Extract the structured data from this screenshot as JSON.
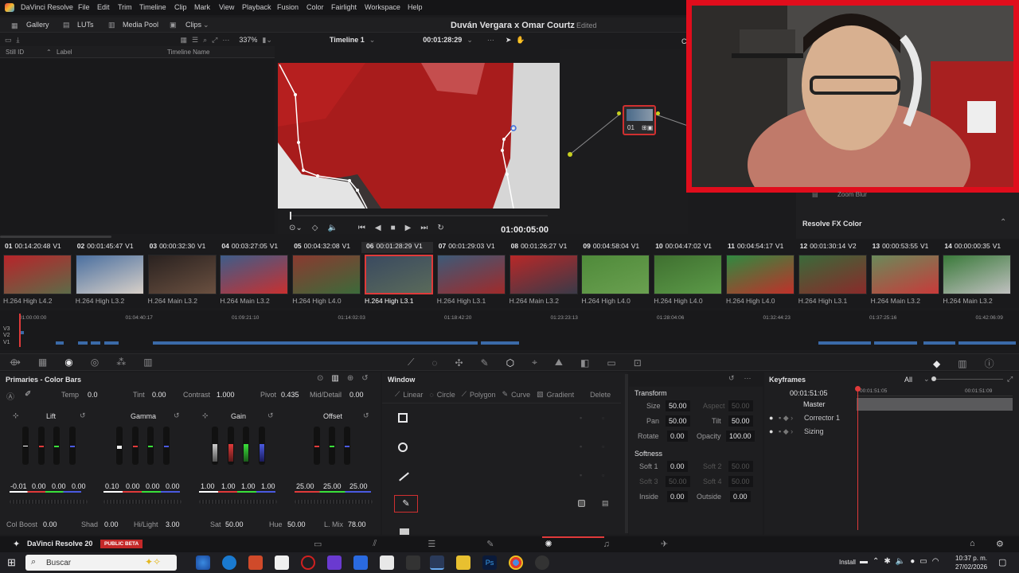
{
  "menubar": {
    "app": "DaVinci Resolve",
    "items": [
      "File",
      "Edit",
      "Trim",
      "Timeline",
      "Clip",
      "Mark",
      "View",
      "Playback",
      "Fusion",
      "Color",
      "Fairlight",
      "Workspace",
      "Help"
    ],
    "project_title": "Duván Vergara x Omar Courtz",
    "status": "Edited"
  },
  "toolbar": {
    "gallery": "Gallery",
    "luts": "LUTs",
    "media_pool": "Media Pool",
    "clips": "Clips",
    "zoom": "337%",
    "timeline": "Timeline 1",
    "timecode": "00:01:28:29"
  },
  "gallery": {
    "columns": [
      "Still ID",
      "Label",
      "Timeline Name"
    ]
  },
  "viewer": {
    "timecode": "01:00:05:00"
  },
  "node": {
    "label": "01"
  },
  "fx": {
    "item": "Zoom Blur",
    "title": "Resolve FX Color"
  },
  "clips": [
    {
      "num": "01",
      "tc": "00:14:20:48",
      "track": "V1",
      "codec": "H.264 High L4.2",
      "c1": "#b8242a",
      "c2": "#5d6b48"
    },
    {
      "num": "02",
      "tc": "00:01:45:47",
      "track": "V1",
      "codec": "H.264 High L3.2",
      "c1": "#4a6fa0",
      "c2": "#d8d0c8"
    },
    {
      "num": "03",
      "tc": "00:00:32:30",
      "track": "V1",
      "codec": "H.264 Main L3.2",
      "c1": "#2a2220",
      "c2": "#6a5040"
    },
    {
      "num": "04",
      "tc": "00:03:27:05",
      "track": "V1",
      "codec": "H.264 Main L3.2",
      "c1": "#3d5d8a",
      "c2": "#c83030"
    },
    {
      "num": "05",
      "tc": "00:04:32:08",
      "track": "V1",
      "codec": "H.264 High L4.0",
      "c1": "#8a3a30",
      "c2": "#3c6a3a"
    },
    {
      "num": "06",
      "tc": "00:01:28:29",
      "track": "V1",
      "codec": "H.264 High L3.1",
      "c1": "#3a4a60",
      "c2": "#5a6a5a",
      "selected": true
    },
    {
      "num": "07",
      "tc": "00:01:29:03",
      "track": "V1",
      "codec": "H.264 High L3.1",
      "c1": "#3c5a78",
      "c2": "#a02a2a"
    },
    {
      "num": "08",
      "tc": "00:01:26:27",
      "track": "V1",
      "codec": "H.264 Main L3.2",
      "c1": "#b82828",
      "c2": "#3a3a48"
    },
    {
      "num": "09",
      "tc": "00:04:58:04",
      "track": "V1",
      "codec": "H.264 High L4.0",
      "c1": "#4f8a3a",
      "c2": "#6aa050"
    },
    {
      "num": "10",
      "tc": "00:04:47:02",
      "track": "V1",
      "codec": "H.264 High L4.0",
      "c1": "#3f7030",
      "c2": "#5c9a48"
    },
    {
      "num": "11",
      "tc": "00:04:54:17",
      "track": "V1",
      "codec": "H.264 High L4.0",
      "c1": "#2f8a40",
      "c2": "#c0302a"
    },
    {
      "num": "12",
      "tc": "00:01:30:14",
      "track": "V2",
      "codec": "H.264 High L3.1",
      "c1": "#3a6a3a",
      "c2": "#8a2a2a"
    },
    {
      "num": "13",
      "tc": "00:00:53:55",
      "track": "V1",
      "codec": "H.264 Main L3.2",
      "c1": "#6a8a5a",
      "c2": "#c83a3a"
    },
    {
      "num": "14",
      "tc": "00:00:00:35",
      "track": "V1",
      "codec": "H.264 Main L3.2",
      "c1": "#3a7a3a",
      "c2": "#c0c0c0"
    }
  ],
  "ruler": [
    "01:00:00:00",
    "01:04:40:17",
    "01:09:21:10",
    "01:14:02:03",
    "01:18:42:20",
    "01:23:23:13",
    "01:28:04:06",
    "01:32:44:23",
    "01:37:25:16",
    "01:42:06:09"
  ],
  "tracks": [
    "V3",
    "V2",
    "V1"
  ],
  "primaries": {
    "title": "Primaries - Color Bars",
    "temp_label": "Temp",
    "temp": "0.0",
    "tint_label": "Tint",
    "tint": "0.00",
    "contrast_label": "Contrast",
    "contrast": "1.000",
    "pivot_label": "Pivot",
    "pivot": "0.435",
    "middetail_label": "Mid/Detail",
    "middetail": "0.00",
    "wheels": [
      {
        "name": "Lift",
        "vals": [
          "-0.01",
          "0.00",
          "0.00",
          "0.00"
        ]
      },
      {
        "name": "Gamma",
        "vals": [
          "0.10",
          "0.00",
          "0.00",
          "0.00"
        ]
      },
      {
        "name": "Gain",
        "vals": [
          "1.00",
          "1.00",
          "1.00",
          "1.00"
        ]
      },
      {
        "name": "Offset",
        "vals": [
          "25.00",
          "25.00",
          "25.00"
        ]
      }
    ],
    "colboost_label": "Col Boost",
    "colboost": "0.00",
    "shad_label": "Shad",
    "shad": "0.00",
    "hilight_label": "Hi/Light",
    "hilight": "3.00",
    "sat_label": "Sat",
    "sat": "50.00",
    "hue_label": "Hue",
    "hue": "50.00",
    "lmix_label": "L. Mix",
    "lmix": "78.00"
  },
  "window": {
    "title": "Window",
    "tools": [
      "Linear",
      "Circle",
      "Polygon",
      "Curve",
      "Gradient"
    ],
    "delete": "Delete"
  },
  "transform": {
    "title": "Transform",
    "size_label": "Size",
    "size": "50.00",
    "aspect_label": "Aspect",
    "aspect": "50.00",
    "pan_label": "Pan",
    "pan": "50.00",
    "tilt_label": "Tilt",
    "tilt": "50.00",
    "rotate_label": "Rotate",
    "rotate": "0.00",
    "opacity_label": "Opacity",
    "opacity": "100.00",
    "softness_title": "Softness",
    "soft1_label": "Soft 1",
    "soft1": "0.00",
    "soft2_label": "Soft 2",
    "soft2": "50.00",
    "soft3_label": "Soft 3",
    "soft3": "50.00",
    "soft4_label": "Soft 4",
    "soft4": "50.00",
    "inside_label": "Inside",
    "inside": "0.00",
    "outside_label": "Outside",
    "outside": "0.00"
  },
  "keyframes": {
    "title": "Keyframes",
    "filter": "All",
    "timecode": "00:01:51:05",
    "tick1": "00:01:51:05",
    "tick2": "00:01:51:09",
    "master": "Master",
    "items": [
      "Corrector 1",
      "Sizing"
    ]
  },
  "statusbar": {
    "app": "DaVinci Resolve 20",
    "badge": "PUBLIC BETA"
  },
  "taskbar": {
    "search": "Buscar",
    "time": "10:37 p. m.",
    "date": "27/02/2026",
    "install": "Install"
  }
}
